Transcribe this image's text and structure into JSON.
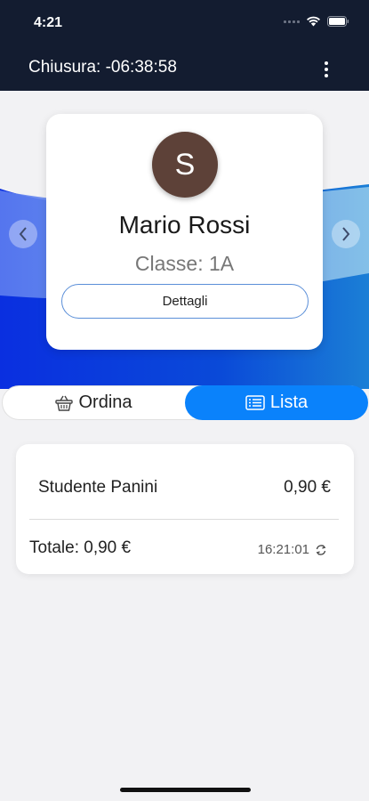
{
  "status_bar": {
    "time": "4:21"
  },
  "app_bar": {
    "title": "Chiusura: -06:38:58"
  },
  "profile": {
    "initial": "S",
    "name": "Mario Rossi",
    "class_label": "Classe: 1A",
    "details_label": "Dettagli"
  },
  "tabs": [
    {
      "label": "Ordina",
      "icon": "basket-icon",
      "active": false
    },
    {
      "label": "Lista",
      "icon": "list-icon",
      "active": true
    }
  ],
  "order": {
    "items": [
      {
        "name": "Studente Panini",
        "price": "0,90 €"
      }
    ],
    "total_label": "Totale: 0,90 €",
    "timestamp": "16:21:01"
  },
  "colors": {
    "app_bar_bg": "#131c30",
    "accent": "#0a82fb",
    "avatar_bg": "#5d4138"
  }
}
